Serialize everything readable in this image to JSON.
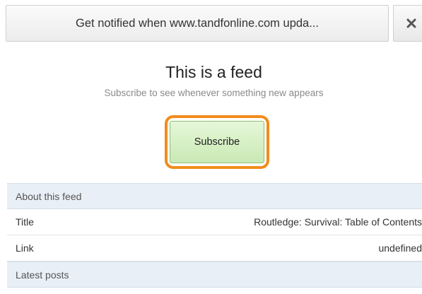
{
  "notification": {
    "message": "Get notified when www.tandfonline.com upda...",
    "close_icon": "close-x-icon"
  },
  "feed": {
    "title": "This is a feed",
    "subtitle": "Subscribe to see whenever something new appears",
    "subscribe_label": "Subscribe",
    "focus_ring_color": "#f28c1c",
    "button_color": "#d4eec2"
  },
  "about": {
    "header": "About this feed",
    "rows": [
      {
        "label": "Title",
        "value": "Routledge: Survival: Table of Contents"
      },
      {
        "label": "Link",
        "value": "undefined"
      }
    ]
  },
  "latest": {
    "header": "Latest posts"
  }
}
